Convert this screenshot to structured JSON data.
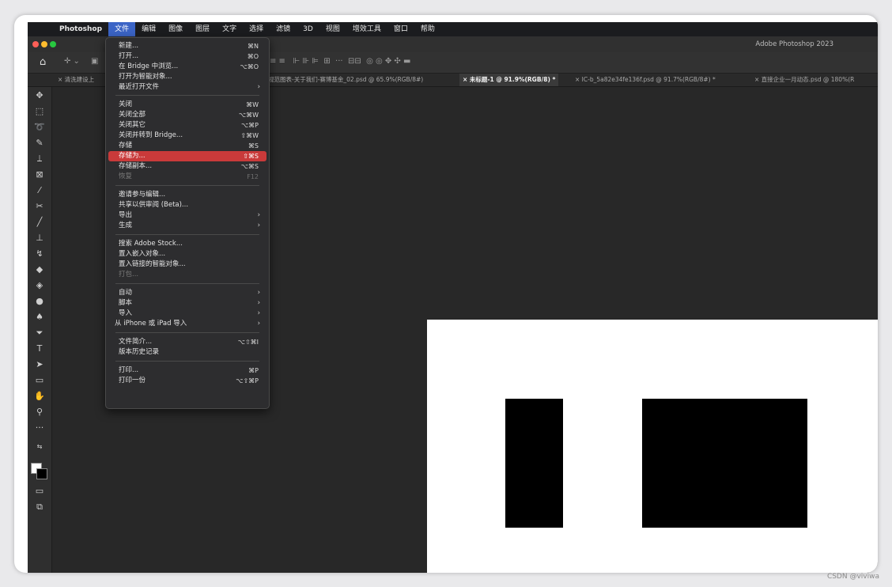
{
  "menubar": {
    "app": "Photoshop",
    "items": [
      "文件",
      "编辑",
      "图像",
      "图层",
      "文字",
      "选择",
      "滤镜",
      "3D",
      "视图",
      "增效工具",
      "窗口",
      "帮助"
    ]
  },
  "window_title": "Adobe Photoshop 2023",
  "tabs": [
    "× 清洗建设上",
    "规范图表-关于我们-赛博基金_02.psd @ 65.9%(RGB/8#)",
    "× 未标题-1 @ 91.9%(RGB/8) *",
    "× IC-b_5a82e34fe136f.psd @ 91.7%(RGB/8#) *",
    "× 直接企业一月动态.psd @ 180%(R"
  ],
  "file_menu": {
    "groups": [
      [
        {
          "label": "新建...",
          "shortcut": "⌘N"
        },
        {
          "label": "打开...",
          "shortcut": "⌘O"
        },
        {
          "label": "在 Bridge 中浏览...",
          "shortcut": "⌥⌘O"
        },
        {
          "label": "打开为智能对象..."
        },
        {
          "label": "最近打开文件",
          "submenu": true
        }
      ],
      [
        {
          "label": "关闭",
          "shortcut": "⌘W"
        },
        {
          "label": "关闭全部",
          "shortcut": "⌥⌘W"
        },
        {
          "label": "关闭其它",
          "shortcut": "⌥⌘P"
        },
        {
          "label": "关闭并转到 Bridge...",
          "shortcut": "⇧⌘W"
        },
        {
          "label": "存储",
          "shortcut": "⌘S"
        },
        {
          "label": "存储为...",
          "shortcut": "⇧⌘S",
          "highlighted": true
        },
        {
          "label": "存储副本...",
          "shortcut": "⌥⌘S"
        },
        {
          "label": "恢复",
          "shortcut": "F12",
          "disabled": true
        }
      ],
      [
        {
          "label": "邀请参与编辑..."
        },
        {
          "label": "共享以供审阅 (Beta)..."
        },
        {
          "label": "导出",
          "submenu": true
        },
        {
          "label": "生成",
          "submenu": true
        }
      ],
      [
        {
          "label": "搜索 Adobe Stock..."
        },
        {
          "label": "置入嵌入对象..."
        },
        {
          "label": "置入链接的智能对象..."
        },
        {
          "label": "打包...",
          "disabled": true
        }
      ],
      [
        {
          "label": "自动",
          "submenu": true
        },
        {
          "label": "脚本",
          "submenu": true
        },
        {
          "label": "导入",
          "submenu": true
        },
        {
          "label": "从 iPhone 或 iPad 导入",
          "submenu": true
        }
      ],
      [
        {
          "label": "文件简介...",
          "shortcut": "⌥⇧⌘I"
        },
        {
          "label": "版本历史记录"
        }
      ],
      [
        {
          "label": "打印...",
          "shortcut": "⌘P"
        },
        {
          "label": "打印一份",
          "shortcut": "⌥⇧⌘P"
        }
      ]
    ]
  },
  "watermark": "CSDN @viviwa"
}
